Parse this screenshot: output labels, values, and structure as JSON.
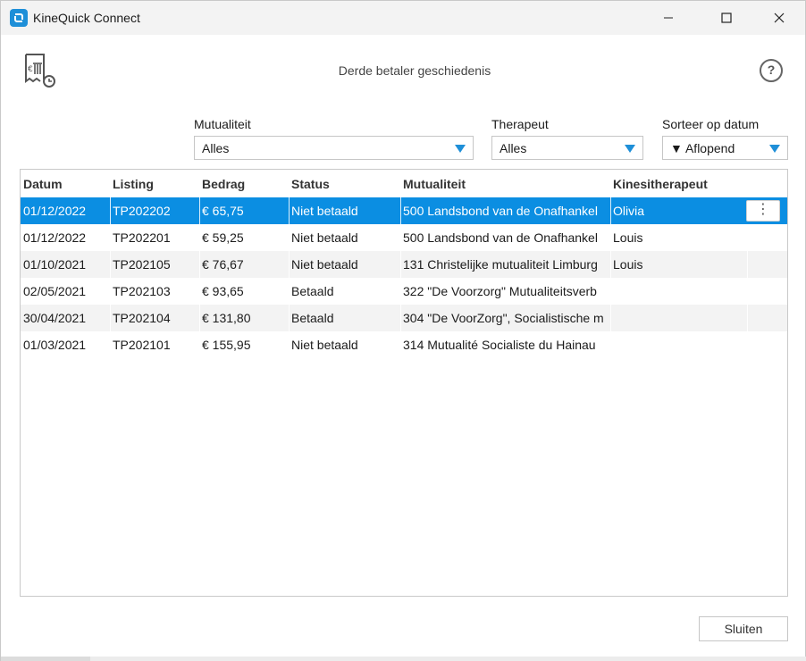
{
  "window": {
    "title": "KineQuick Connect"
  },
  "header": {
    "title": "Derde betaler geschiedenis",
    "help_symbol": "?"
  },
  "filters": {
    "mutualiteit": {
      "label": "Mutualiteit",
      "value": "Alles"
    },
    "therapeut": {
      "label": "Therapeut",
      "value": "Alles"
    },
    "sort": {
      "label": "Sorteer op datum",
      "value": "▼ Aflopend"
    }
  },
  "table": {
    "columns": [
      "Datum",
      "Listing",
      "Bedrag",
      "Status",
      "Mutualiteit",
      "Kinesitherapeut"
    ],
    "rows": [
      {
        "datum": "01/12/2022",
        "listing": "TP202202",
        "bedrag": "€ 65,75",
        "status": "Niet betaald",
        "mutualiteit": "500 Landsbond van de Onafhankel",
        "kine": "Olivia",
        "selected": true
      },
      {
        "datum": "01/12/2022",
        "listing": "TP202201",
        "bedrag": "€ 59,25",
        "status": "Niet betaald",
        "mutualiteit": "500 Landsbond van de Onafhankel",
        "kine": "Louis"
      },
      {
        "datum": "01/10/2021",
        "listing": "TP202105",
        "bedrag": "€ 76,67",
        "status": "Niet betaald",
        "mutualiteit": "131 Christelijke mutualiteit Limburg",
        "kine": "Louis"
      },
      {
        "datum": "02/05/2021",
        "listing": "TP202103",
        "bedrag": "€ 93,65",
        "status": "Betaald",
        "mutualiteit": "322 \"De Voorzorg\" Mutualiteitsverb",
        "kine": ""
      },
      {
        "datum": "30/04/2021",
        "listing": "TP202104",
        "bedrag": "€ 131,80",
        "status": "Betaald",
        "mutualiteit": "304 \"De VoorZorg\", Socialistische m",
        "kine": ""
      },
      {
        "datum": "01/03/2021",
        "listing": "TP202101",
        "bedrag": "€ 155,95",
        "status": "Niet betaald",
        "mutualiteit": "314 Mutualité Socialiste du Hainau",
        "kine": ""
      }
    ],
    "row_menu_symbol": "⋮"
  },
  "footer": {
    "close_label": "Sluiten"
  },
  "colors": {
    "accent": "#0b8ee2",
    "row_alt": "#f3f3f3"
  },
  "icons": [
    "app-logo-icon",
    "minimize-icon",
    "maximize-icon",
    "close-icon",
    "third-party-payment-history-icon",
    "help-icon",
    "dropdown-arrow-icon",
    "more-options-icon"
  ]
}
